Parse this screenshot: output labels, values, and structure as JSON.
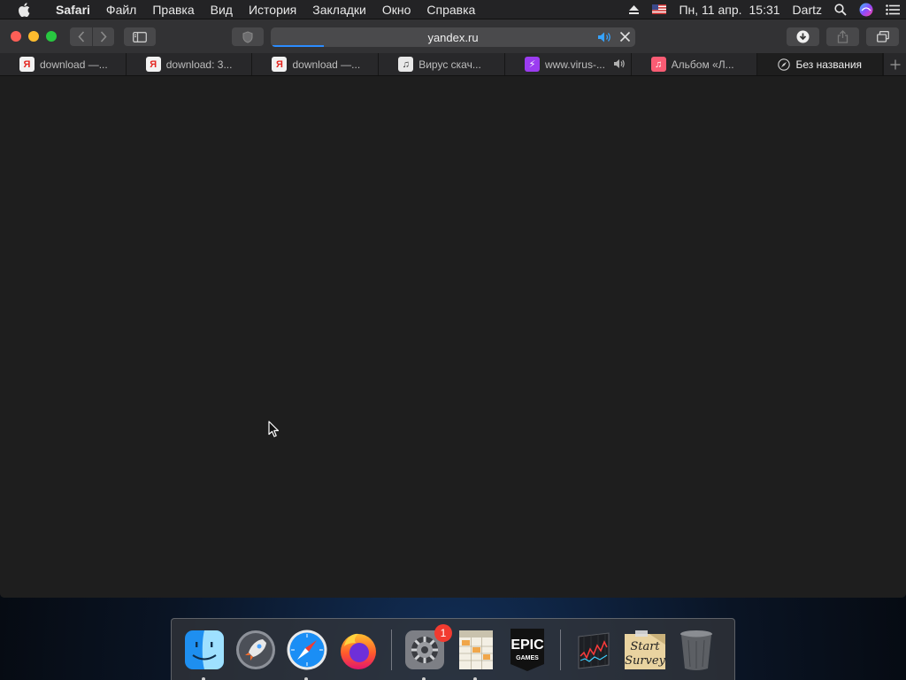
{
  "menubar": {
    "app_name": "Safari",
    "items": [
      "Файл",
      "Правка",
      "Вид",
      "История",
      "Закладки",
      "Окно",
      "Справка"
    ],
    "status": {
      "date": "Пн, 11 апр.",
      "time": "15:31",
      "user": "Dartz",
      "icons": [
        "eject-icon",
        "us-flag-icon",
        "spotlight-search-icon",
        "siri-icon",
        "notification-center-icon"
      ]
    }
  },
  "window": {
    "address": "yandex.ru",
    "load_progress": 0.14,
    "tabs": [
      {
        "title": "download —...",
        "favicon": "Я",
        "favicon_kind": "yandex"
      },
      {
        "title": "download: 3...",
        "favicon": "Я",
        "favicon_kind": "yandex"
      },
      {
        "title": "download —...",
        "favicon": "Я",
        "favicon_kind": "yandex"
      },
      {
        "title": "Вирус скач...",
        "favicon": "♫",
        "favicon_kind": "music"
      },
      {
        "title": "www.virus-...",
        "favicon": "⚡",
        "favicon_kind": "bolt",
        "playing_audio": true
      },
      {
        "title": "Альбом «Л...",
        "favicon": "♫",
        "favicon_kind": "apple-music"
      },
      {
        "title": "Без названия",
        "favicon_kind": "compass",
        "active": true
      }
    ]
  },
  "dock": {
    "apps": [
      {
        "name": "finder",
        "running": true
      },
      {
        "name": "launchpad",
        "running": false
      },
      {
        "name": "safari",
        "running": true
      },
      {
        "name": "firefox",
        "running": false
      },
      {
        "name": "system-preferences",
        "running": true,
        "badge": "1"
      },
      {
        "name": "numbers",
        "running": true
      },
      {
        "name": "epic-games",
        "running": false,
        "label_top": "EPIC",
        "label_bottom": "GAMES"
      },
      {
        "name": "stocks-monitor",
        "running": false
      },
      {
        "name": "start-survey",
        "running": false,
        "label_line1": "Start",
        "label_line2": "Survey"
      },
      {
        "name": "trash",
        "running": false
      }
    ]
  },
  "colors": {
    "close": "#fe5f57",
    "minimize": "#febc2e",
    "maximize": "#28c840",
    "progress": "#2b8cff",
    "badge": "#f23b30"
  }
}
